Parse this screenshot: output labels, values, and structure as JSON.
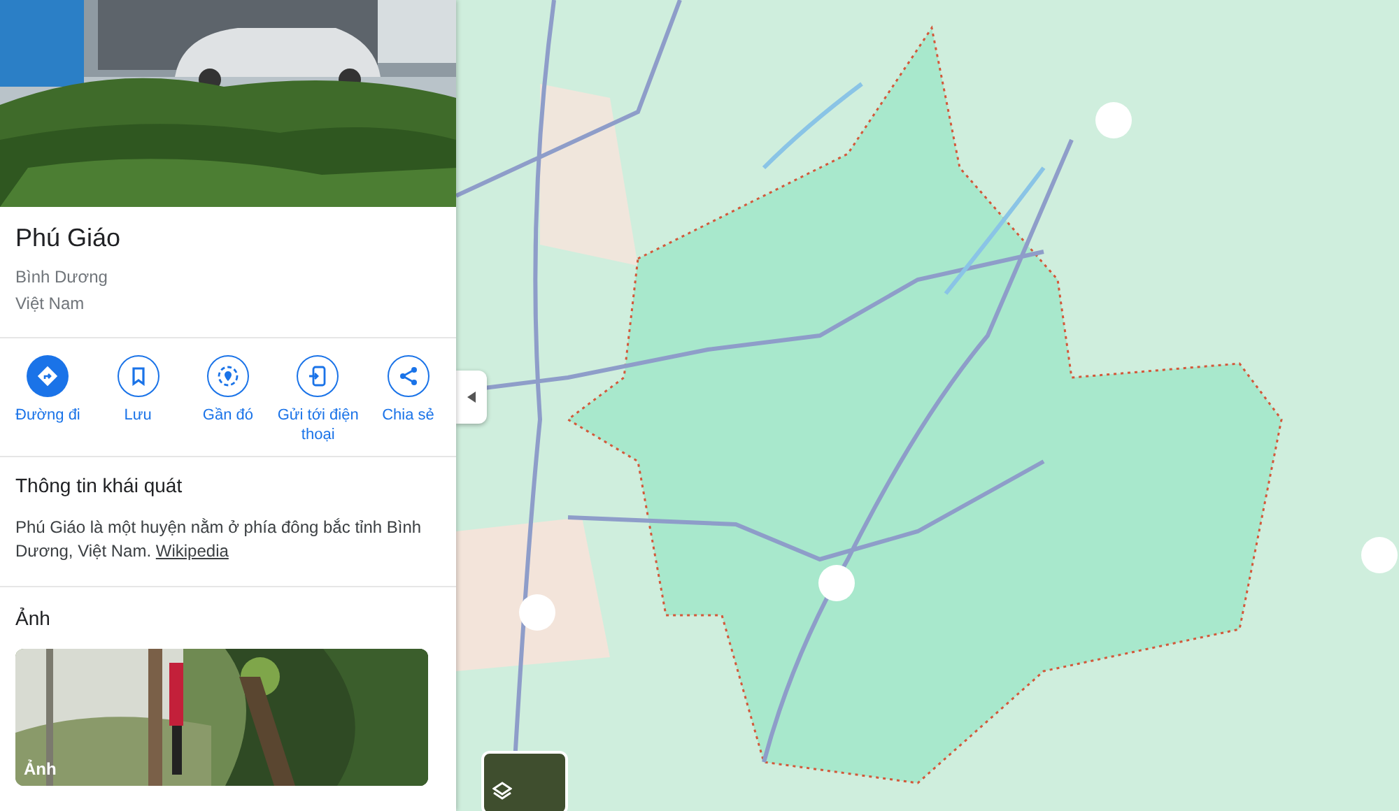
{
  "place": {
    "title": "Phú Giáo",
    "lines": [
      "Bình Dương",
      "Việt Nam"
    ]
  },
  "actions": [
    {
      "label": "Đường đi",
      "kind": "primary"
    },
    {
      "label": "Lưu",
      "kind": "outline"
    },
    {
      "label": "Gần đó",
      "kind": "outline"
    },
    {
      "label": "Gửi tới điện thoại",
      "kind": "outline"
    },
    {
      "label": "Chia sẻ",
      "kind": "outline"
    }
  ],
  "overview": {
    "heading": "Thông tin khái quát",
    "text": "Phú Giáo là một huyện nằm ở phía đông bắc tỉnh Bình Dương, Việt Nam.",
    "link": "Wikipedia"
  },
  "photos": {
    "heading": "Ảnh",
    "caption": "Ảnh"
  }
}
